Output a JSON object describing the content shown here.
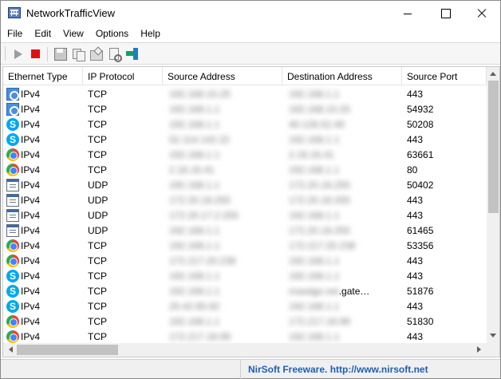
{
  "window": {
    "title": "NetworkTrafficView"
  },
  "menu": [
    "File",
    "Edit",
    "View",
    "Options",
    "Help"
  ],
  "columns": [
    "Ethernet Type",
    "IP Protocol",
    "Source Address",
    "Destination Address",
    "Source Port"
  ],
  "rows": [
    {
      "icon": "ethernet-icon",
      "type": "IPv4",
      "protocol": "TCP",
      "src": "192.168.10.25",
      "dst": "192.168.1.1",
      "port": "443"
    },
    {
      "icon": "ethernet-icon",
      "type": "IPv4",
      "protocol": "TCP",
      "src": "192.168.1.1",
      "dst": "192.168.10.25",
      "port": "54932"
    },
    {
      "icon": "skype-icon",
      "type": "IPv4",
      "protocol": "TCP",
      "src": "192.168.1.1",
      "dst": "40.126.52.40",
      "port": "50208"
    },
    {
      "icon": "skype-icon",
      "type": "IPv4",
      "protocol": "TCP",
      "src": "52.114.142.22",
      "dst": "192.168.1.1",
      "port": "443"
    },
    {
      "icon": "chrome-icon",
      "type": "IPv4",
      "protocol": "TCP",
      "src": "192.168.1.1",
      "dst": "2.18.16.41",
      "port": "63661"
    },
    {
      "icon": "chrome-icon",
      "type": "IPv4",
      "protocol": "TCP",
      "src": "2.18.16.41",
      "dst": "192.168.1.1",
      "port": "80"
    },
    {
      "icon": "app-window-icon",
      "type": "IPv4",
      "protocol": "UDP",
      "src": "192.168.1.1",
      "dst": "172.20.18.255",
      "port": "50402"
    },
    {
      "icon": "app-window-icon",
      "type": "IPv4",
      "protocol": "UDP",
      "src": "172.20.18.255",
      "dst": "172.20.18.255",
      "port": "443"
    },
    {
      "icon": "app-window-icon",
      "type": "IPv4",
      "protocol": "UDP",
      "src": "172.20.17.2.255",
      "dst": "192.168.1.1",
      "port": "443"
    },
    {
      "icon": "app-window-icon",
      "type": "IPv4",
      "protocol": "UDP",
      "src": "192.168.1.1",
      "dst": "172.20.18.255",
      "port": "61465"
    },
    {
      "icon": "chrome-icon",
      "type": "IPv4",
      "protocol": "TCP",
      "src": "192.168.1.1",
      "dst": "172.217.20.238",
      "port": "53356"
    },
    {
      "icon": "chrome-icon",
      "type": "IPv4",
      "protocol": "TCP",
      "src": "172.217.20.238",
      "dst": "192.168.1.1",
      "port": "443"
    },
    {
      "icon": "skype-icon",
      "type": "IPv4",
      "protocol": "TCP",
      "src": "192.168.1.1",
      "dst": "192.168.1.1",
      "port": "443"
    },
    {
      "icon": "skype-icon",
      "type": "IPv4",
      "protocol": "TCP",
      "src": "192.168.1.1",
      "dst": "msedge.net",
      "dst_visible": ".gate…",
      "port": "51876"
    },
    {
      "icon": "skype-icon",
      "type": "IPv4",
      "protocol": "TCP",
      "src": "20.42.65.92",
      "dst": "192.168.1.1",
      "port": "443"
    },
    {
      "icon": "chrome-icon",
      "type": "IPv4",
      "protocol": "TCP",
      "src": "192.168.1.1",
      "dst": "172.217.18.99",
      "port": "51830"
    },
    {
      "icon": "chrome-icon",
      "type": "IPv4",
      "protocol": "TCP",
      "src": "172.217.18.99",
      "dst": "192.168.1.1",
      "port": "443"
    }
  ],
  "status": {
    "link": "NirSoft Freeware.  http://www.nirsoft.net"
  }
}
